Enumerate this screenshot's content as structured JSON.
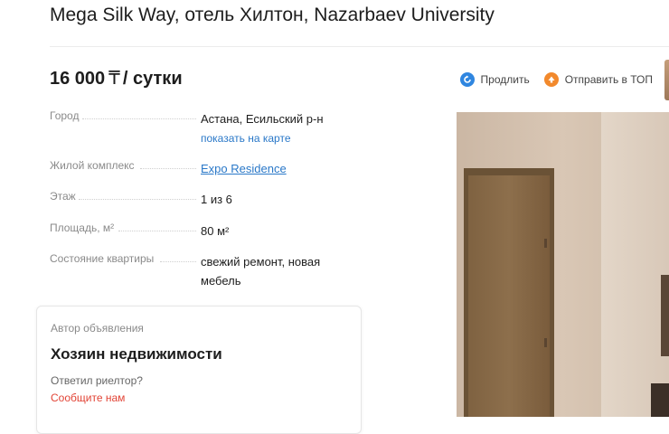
{
  "listing": {
    "title": "Mega Silk Way, отель Хилтон, Nazarbaev University",
    "price": {
      "amount": "16 000",
      "currency": "₸",
      "period": "/ сутки"
    }
  },
  "actions": [
    {
      "label": "Продлить",
      "icon": "refresh-icon",
      "color": "#2f86e0"
    },
    {
      "label": "Отправить в ТОП",
      "icon": "arrow-up-icon",
      "color": "#f2892c"
    }
  ],
  "details": {
    "city": {
      "label": "Город",
      "value": "Астана, Есильский р-н",
      "map_link": "показать на карте"
    },
    "complex": {
      "label": "Жилой комплекс",
      "value": "Expo Residence"
    },
    "floor": {
      "label": "Этаж",
      "value": "1 из 6"
    },
    "area": {
      "label": "Площадь, м²",
      "value": "80 м²"
    },
    "condition": {
      "label": "Состояние квартиры",
      "value_line1": "свежий ремонт, новая",
      "value_line2": "мебель"
    }
  },
  "author_card": {
    "label": "Автор объявления",
    "type": "Хозяин недвижимости",
    "question": "Ответил риелтор?",
    "report_link": "Сообщите нам"
  },
  "colors": {
    "link": "#2a78c8",
    "report": "#e24436",
    "label_gray": "#8a8a8a"
  }
}
